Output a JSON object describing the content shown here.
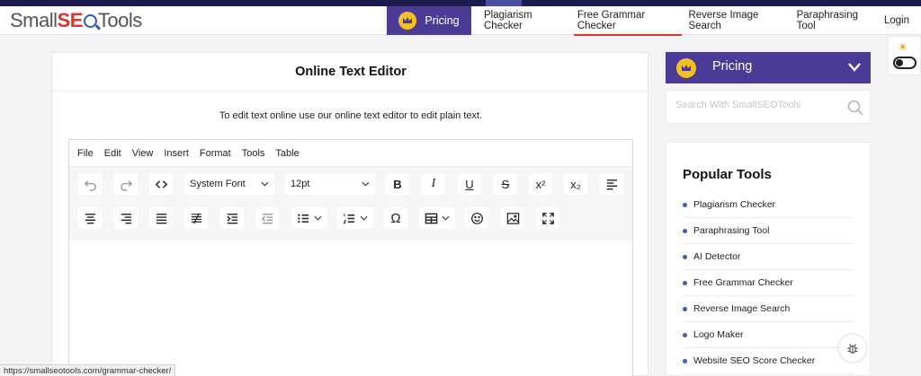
{
  "logo": {
    "part1": "Small",
    "part2": "SE",
    "part3": "Tools"
  },
  "nav": {
    "pricing": "Pricing",
    "links": [
      "Plagiarism Checker",
      "Free Grammar Checker",
      "Reverse Image Search",
      "Paraphrasing Tool",
      "Login"
    ],
    "active_index": 1
  },
  "editor_card": {
    "title": "Online Text Editor",
    "subtitle": "To edit text online use our online text editor to edit plain text.",
    "menu": [
      "File",
      "Edit",
      "View",
      "Insert",
      "Format",
      "Tools",
      "Table"
    ],
    "font_family": "System Font",
    "font_size": "12pt"
  },
  "sidebar": {
    "pricing": "Pricing",
    "search_placeholder": "Search With SmallSEOTools",
    "popular_title": "Popular Tools",
    "tools": [
      "Plagiarism Checker",
      "Paraphrasing Tool",
      "AI Detector",
      "Free Grammar Checker",
      "Reverse Image Search",
      "Logo Maker",
      "Website SEO Score Checker"
    ]
  },
  "status_url": "https://smallseotools.com/grammar-checker/",
  "colors": {
    "brand_purple": "#4b3a96",
    "accent_red": "#e0322f",
    "crown_yellow": "#f5c022"
  },
  "icons": [
    "crown-icon",
    "sun-icon",
    "undo-icon",
    "redo-icon",
    "code-icon",
    "bold-icon",
    "italic-icon",
    "underline-icon",
    "strikethrough-icon",
    "superscript-icon",
    "subscript-icon",
    "align-left-icon",
    "align-center-icon",
    "align-right-icon",
    "justify-icon",
    "clear-format-icon",
    "indent-icon",
    "outdent-icon",
    "bullet-list-icon",
    "numbered-list-icon",
    "omega-icon",
    "table-icon",
    "emoji-icon",
    "image-icon",
    "fullscreen-icon",
    "search-icon",
    "bug-icon"
  ]
}
